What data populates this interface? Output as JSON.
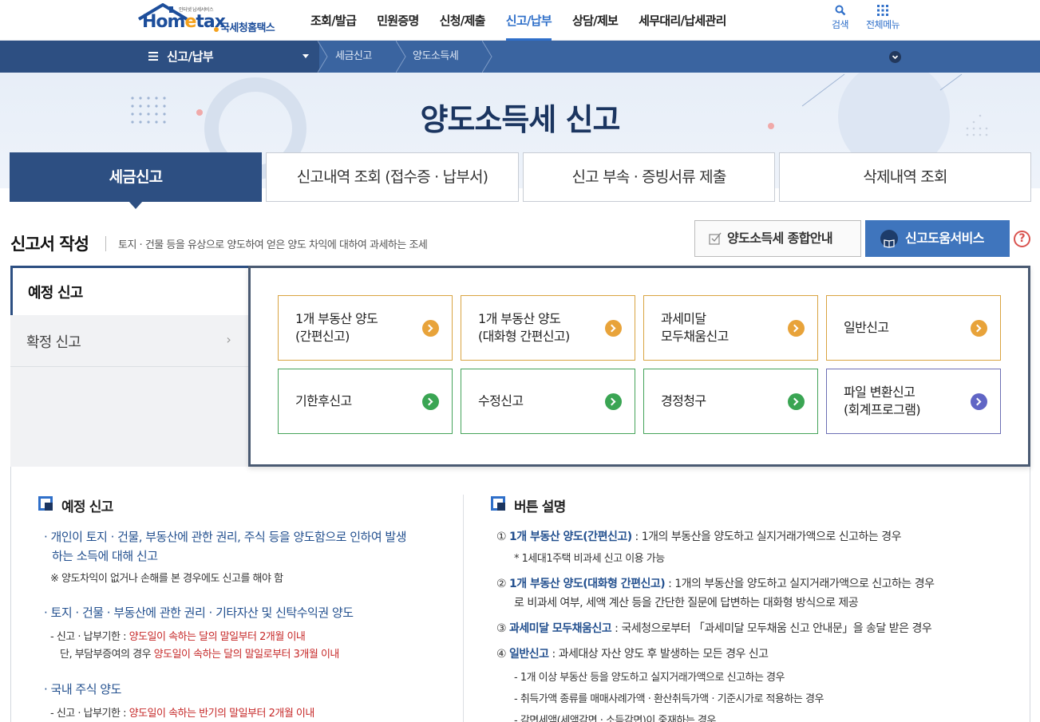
{
  "header": {
    "logo_small": "인터넷 납세서비스",
    "logo_brand_a": "Hom",
    "logo_brand_e": "e",
    "logo_brand_b": "tax",
    "logo_sub": "국세청홈택스",
    "nav": [
      "조회/발급",
      "민원증명",
      "신청/제출",
      "신고/납부",
      "상담/제보",
      "세무대리/납세관리"
    ],
    "nav_active_index": 3,
    "search_label": "검색",
    "allmenu_label": "전체메뉴"
  },
  "breadcrumb": {
    "menu_title": "신고/납부",
    "items": [
      "세금신고",
      "양도소득세"
    ]
  },
  "banner": {
    "title": "양도소득세 신고"
  },
  "tabs": [
    "세금신고",
    "신고내역 조회 (접수증 · 납부서)",
    "신고 부속 · 증빙서류 제출",
    "삭제내역 조회"
  ],
  "section": {
    "title": "신고서 작성",
    "desc": "토지 · 건물 등을 유상으로 양도하여 얻은 양도 차익에 대하여 과세하는 조세",
    "guide_btn": "양도소득세 종합안내",
    "help_btn": "신고도움서비스",
    "help_q": "?"
  },
  "side": {
    "active": "예정 신고",
    "other": "확정 신고"
  },
  "cards": [
    {
      "line1": "1개 부동산 양도",
      "line2": "(간편신고)",
      "color": "#e8a33a"
    },
    {
      "line1": "1개 부동산 양도",
      "line2": "(대화형 간편신고)",
      "color": "#e8a33a"
    },
    {
      "line1": "과세미달",
      "line2": "모두채움신고",
      "color": "#e8a33a"
    },
    {
      "line1": "일반신고",
      "line2": "",
      "color": "#e8a33a"
    },
    {
      "line1": "기한후신고",
      "line2": "",
      "color": "#3aa553"
    },
    {
      "line1": "수정신고",
      "line2": "",
      "color": "#3aa553"
    },
    {
      "line1": "경정청구",
      "line2": "",
      "color": "#3aa553"
    },
    {
      "line1": "파일 변환신고",
      "line2": "(회계프로그램)",
      "color": "#6065c5"
    }
  ],
  "left_info": {
    "heading": "예정 신고",
    "p1a": "· 개인이 토지 · 건물, 부동산에 관한 권리, 주식 등을 양도함으로 인하여 발생",
    "p1b": "하는 소득에 대해 신고",
    "p1note": "※ 양도차익이 없거나 손해를 본 경우에도 신고를 해야 함",
    "p2": "· 토지 · 건물 · 부동산에 관한 권리 · 기타자산 및 신탁수익권 양도",
    "p2a_pre": "- 신고 · 납부기한 : ",
    "p2a_red": "양도일이 속하는 달의 말일부터 2개월 이내",
    "p2b_pre": "단, 부담부증여의 경우 ",
    "p2b_red": "양도일이 속하는 달의 말일로부터 3개월 이내",
    "p3": "· 국내 주식 양도",
    "p3a_pre": "- 신고 · 납부기한 : ",
    "p3a_red": "양도일이 속하는 반기의 말일부터 2개월 이내"
  },
  "right_info": {
    "heading": "버튼 설명",
    "i1_num": "①",
    "i1_b": "1개 부동산 양도(간편신고)",
    "i1_t": " : 1개의 부동산을 양도하고 실지거래가액으로 신고하는 경우",
    "i1_note": "* 1세대1주택 비과세 신고 이용 가능",
    "i2_num": "②",
    "i2_b": "1개 부동산 양도(대화형 간편신고)",
    "i2_t": " : 1개의 부동산을 양도하고 실지거래가액으로 신고하는 경우",
    "i2_t2": "로 비과세 여부, 세액 계산 등을 간단한 질문에 답변하는 대화형 방식으로 제공",
    "i3_num": "③",
    "i3_b": "과세미달 모두채움신고",
    "i3_t": " : 국세청으로부터 「과세미달 모두채움 신고 안내문」을 송달 받은 경우",
    "i4_num": "④",
    "i4_b": "일반신고",
    "i4_t": " : 과세대상 자산 양도 후 발생하는 모든 경우 신고",
    "i4_s1": "- 1개 이상 부동산 등을 양도하고 실지거래가액으로 신고하는 경우",
    "i4_s2": "- 취득가액 종류를 매매사례가액 · 환산취득가액 · 기준시가로 적용하는 경우",
    "i4_s3": "- 감면세액(세액감면 · 소득감면)이 중재하는 경우"
  }
}
